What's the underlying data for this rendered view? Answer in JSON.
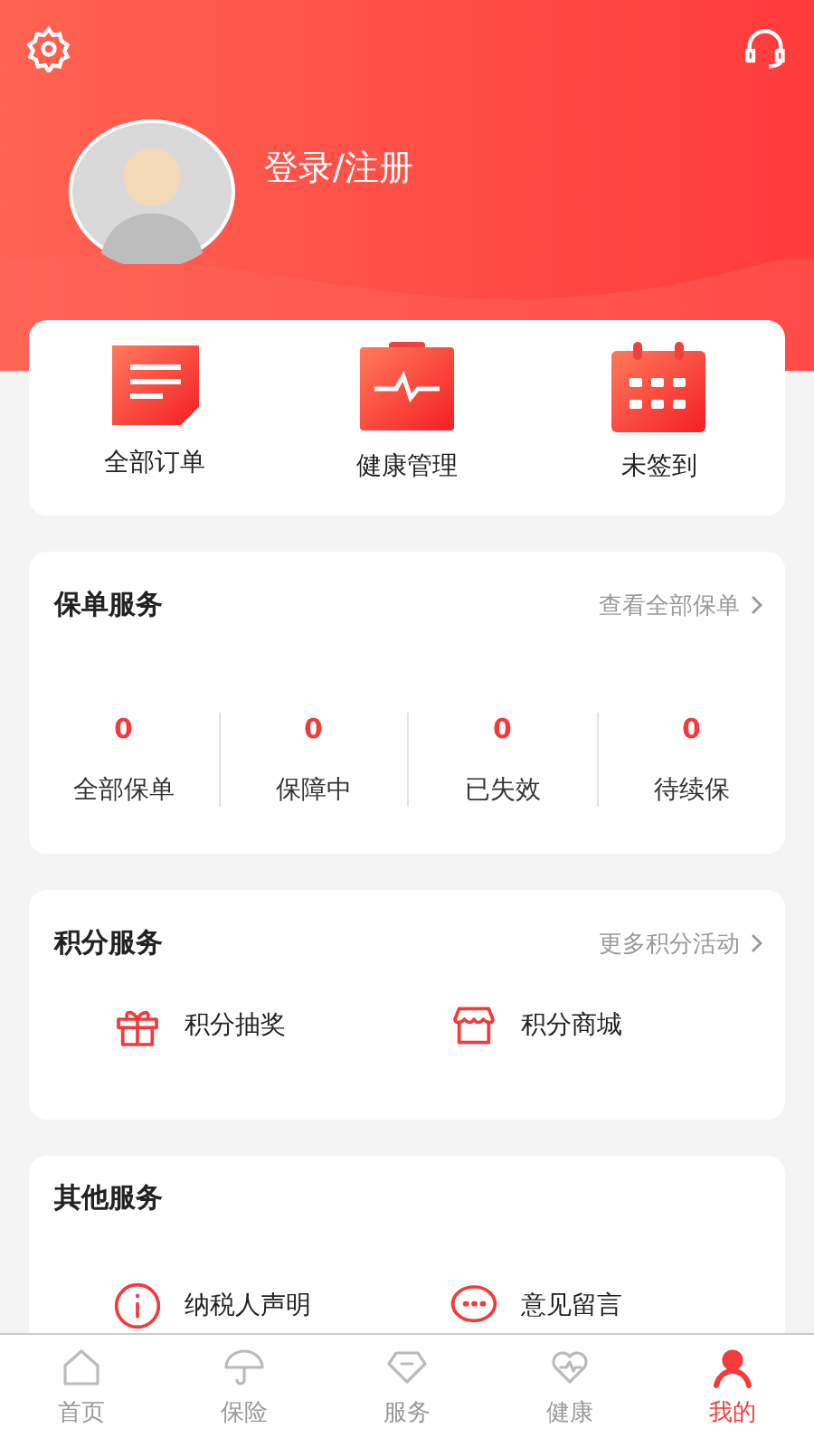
{
  "header": {
    "login_label": "登录/注册"
  },
  "quick_actions": [
    {
      "kind": "orders",
      "label": "全部订单"
    },
    {
      "kind": "health",
      "label": "健康管理"
    },
    {
      "kind": "calendar",
      "label": "未签到"
    }
  ],
  "policy_service": {
    "title": "保单服务",
    "link": "查看全部保单",
    "stats": [
      {
        "count": "0",
        "label": "全部保单"
      },
      {
        "count": "0",
        "label": "保障中"
      },
      {
        "count": "0",
        "label": "已失效"
      },
      {
        "count": "0",
        "label": "待续保"
      }
    ]
  },
  "points_service": {
    "title": "积分服务",
    "link": "更多积分活动",
    "items": [
      {
        "kind": "gift",
        "label": "积分抽奖"
      },
      {
        "kind": "shop",
        "label": "积分商城"
      }
    ]
  },
  "other_service": {
    "title": "其他服务",
    "items": [
      {
        "kind": "info",
        "label": "纳税人声明"
      },
      {
        "kind": "chat",
        "label": "意见留言"
      }
    ]
  },
  "tab_bar": [
    {
      "kind": "home",
      "label": "首页",
      "selected": false
    },
    {
      "kind": "umbrella",
      "label": "保险",
      "selected": false
    },
    {
      "kind": "diamond",
      "label": "服务",
      "selected": false
    },
    {
      "kind": "heart",
      "label": "健康",
      "selected": false
    },
    {
      "kind": "person",
      "label": "我的",
      "selected": true
    }
  ]
}
